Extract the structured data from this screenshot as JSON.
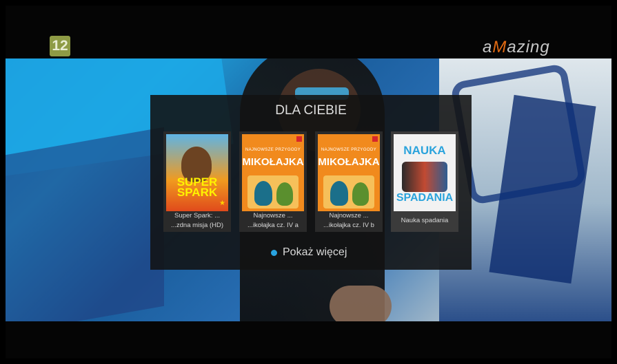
{
  "overlay": {
    "channel_logo": "12",
    "brand_logo_pre": "a",
    "brand_logo_m": "M",
    "brand_logo_post": "azing"
  },
  "panel": {
    "title": "DLA CIEBIE",
    "items": [
      {
        "caption_line1": "Super Spark: ...",
        "caption_line2": "...zdna misja (HD)",
        "poster": "super-spark"
      },
      {
        "caption_line1": "Najnowsze ...",
        "caption_line2": "...ikołajka cz. IV a",
        "poster": "mikolajka"
      },
      {
        "caption_line1": "Najnowsze ...",
        "caption_line2": "...ikołajka cz. IV b",
        "poster": "mikolajka"
      },
      {
        "caption_line1": "Nauka spadania",
        "caption_line2": "",
        "poster": "nauka-spadania"
      }
    ],
    "show_more": "Pokaż więcej"
  },
  "posters": {
    "super_spark_title": "SUPER SPARK",
    "mikolajka_headline": "NAJNOWSZE PRZYGODY",
    "mikolajka_title": "MIKOŁAJKA",
    "nauka_top": "NAUKA",
    "nauka_bottom": "SPADANIA"
  },
  "colors": {
    "accent_dot": "#29a3e0",
    "channel_badge": "#8e9b45",
    "brand_m": "#e26a12"
  }
}
